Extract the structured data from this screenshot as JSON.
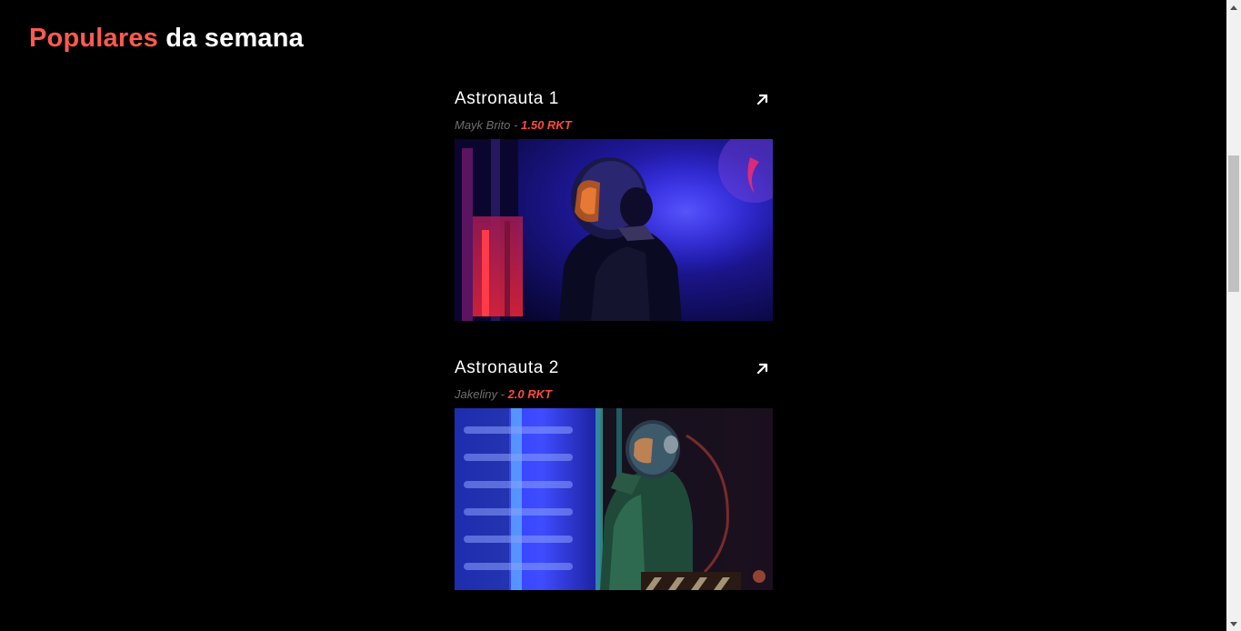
{
  "section": {
    "title_accent": "Populares",
    "title_rest": "da semana"
  },
  "colors": {
    "accent": "#ff5a4f",
    "price": "#ff4b3e",
    "muted": "#6f6f6f",
    "background": "#000000"
  },
  "cards": [
    {
      "title": "Astronauta 1",
      "author": "Mayk Brito",
      "separator": "-",
      "price": "1.50 RKT",
      "link_icon": "arrow-up-right-icon",
      "image": "astronaut-red-blue-photo"
    },
    {
      "title": "Astronauta 2",
      "author": "Jakeliny",
      "separator": "-",
      "price": "2.0 RKT",
      "link_icon": "arrow-up-right-icon",
      "image": "astronaut-green-suit-photo"
    }
  ],
  "scrollbar": {
    "up_icon": "scroll-up-arrow-icon",
    "down_icon": "scroll-down-arrow-icon"
  }
}
